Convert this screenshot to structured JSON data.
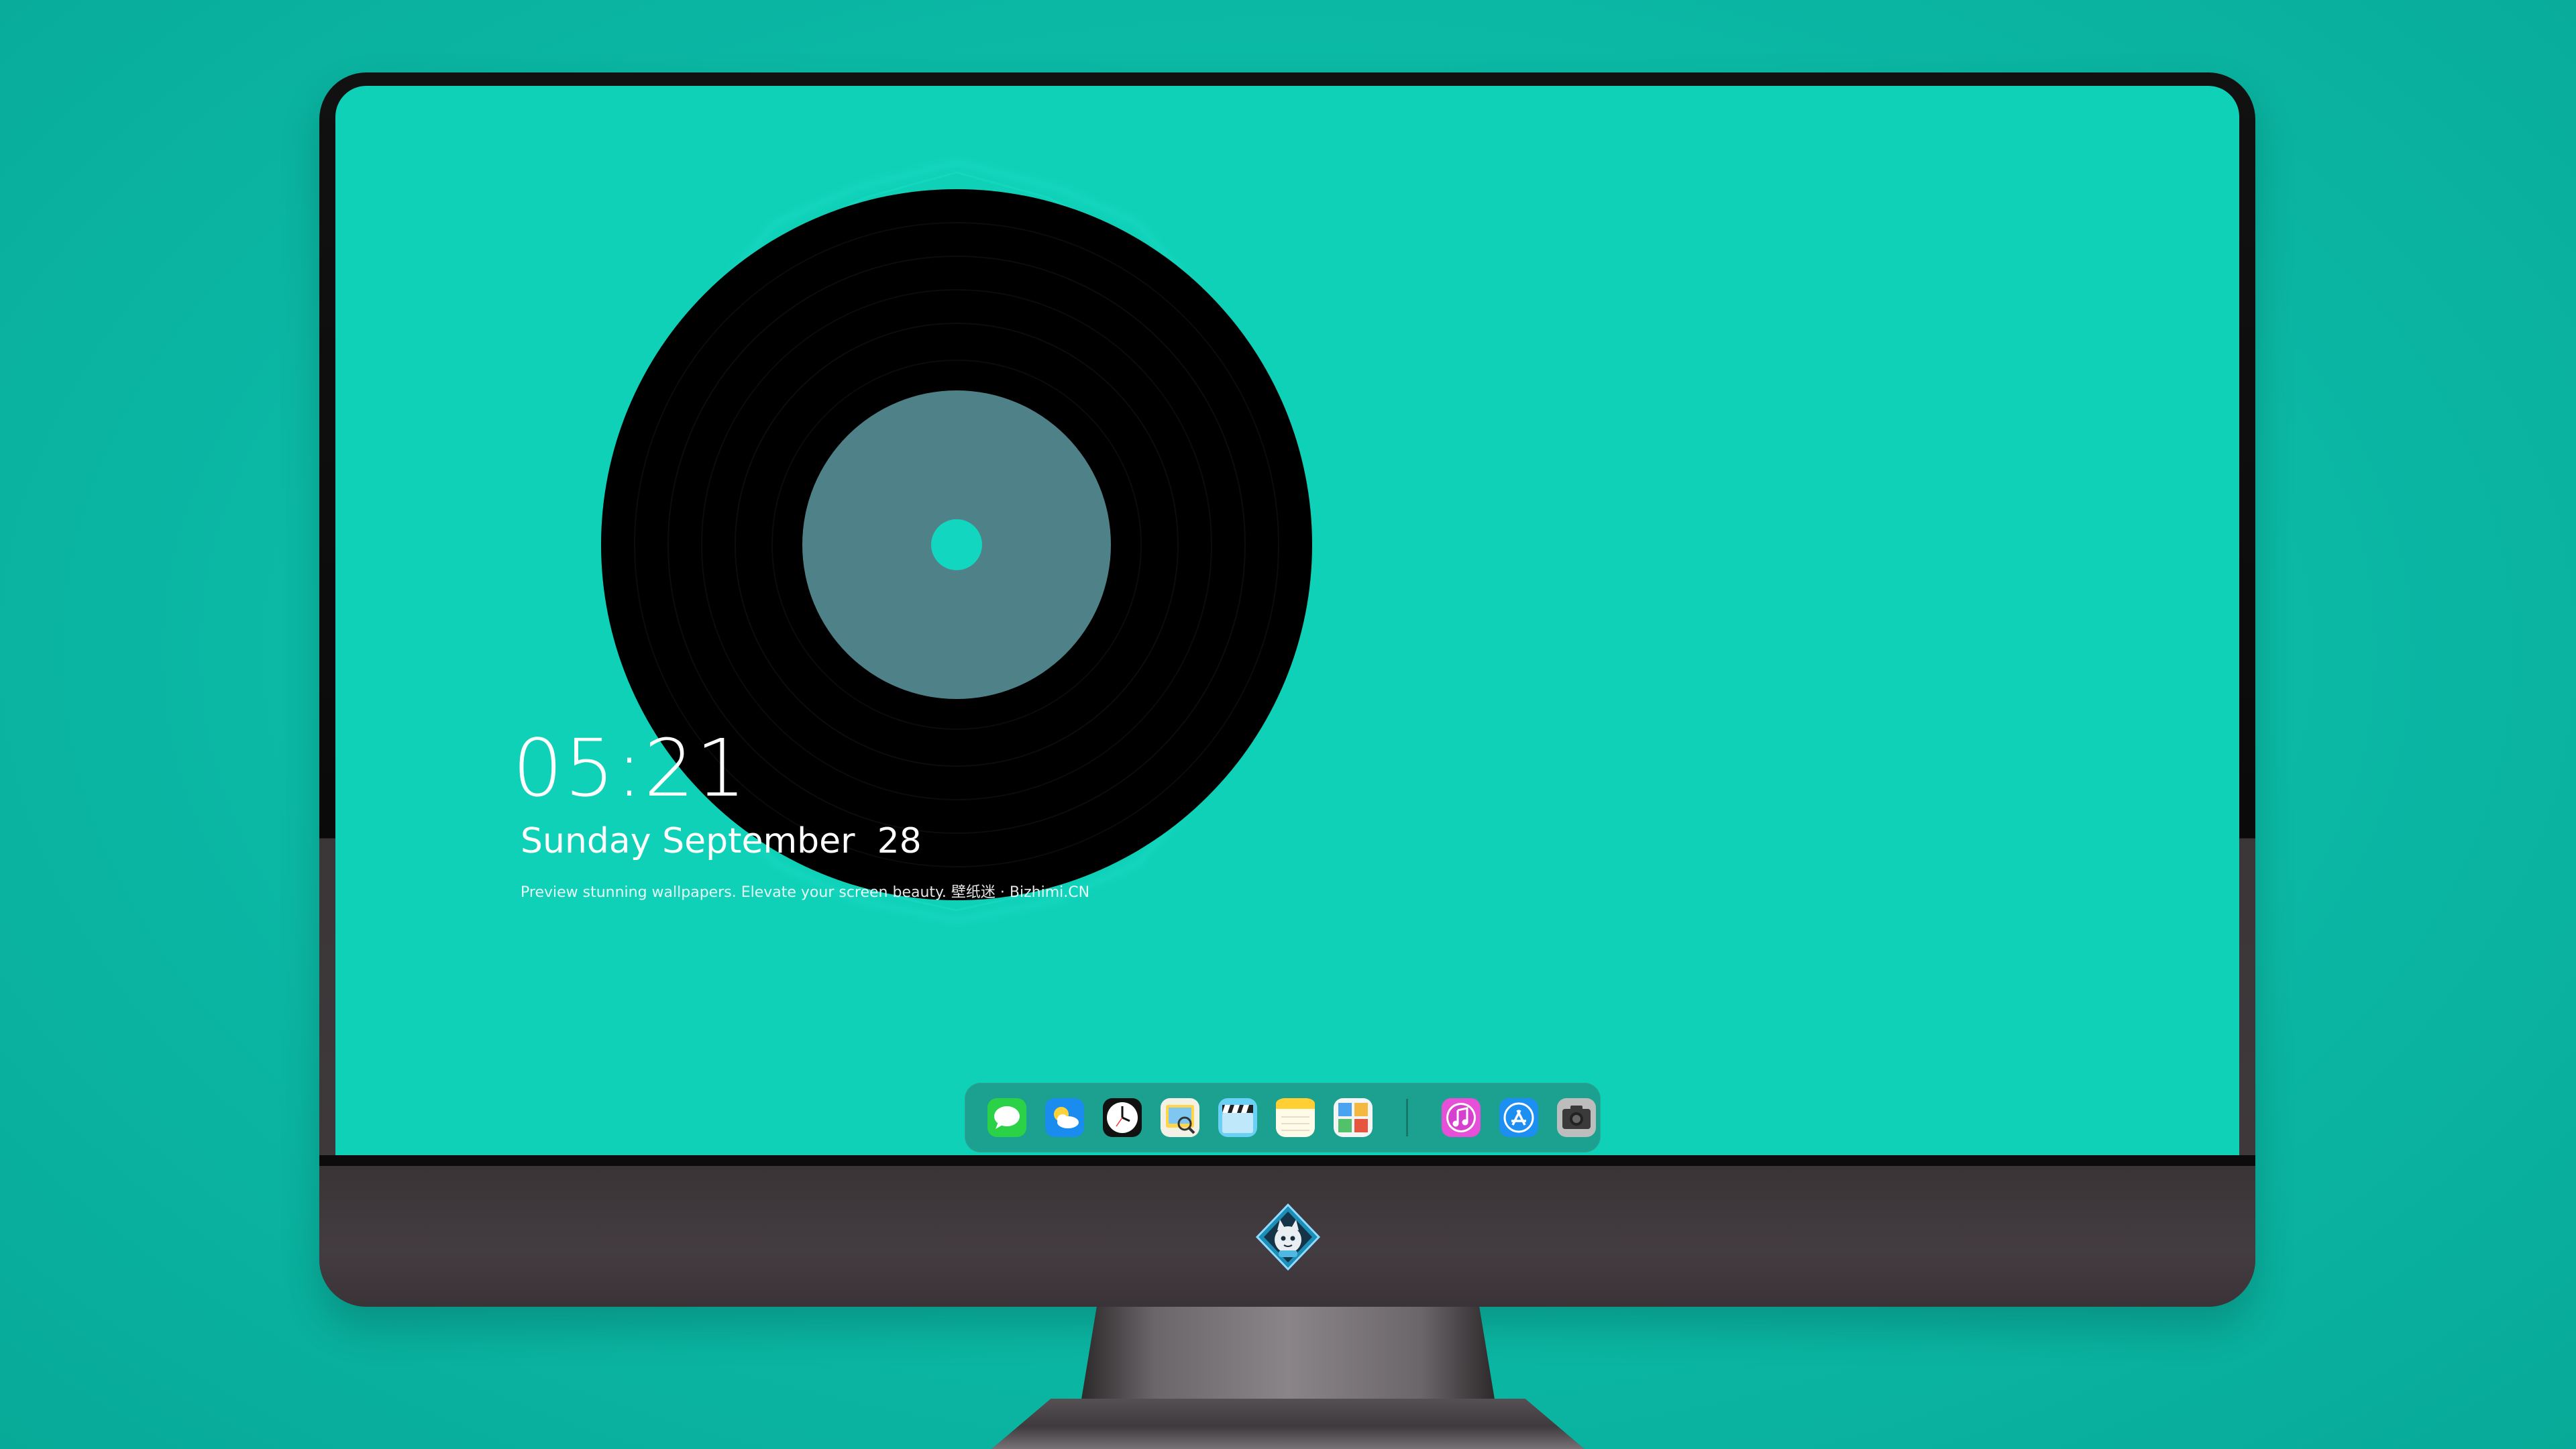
{
  "clock": {
    "time": "05:21",
    "date": "Sunday September  28",
    "tagline": "Preview stunning wallpapers. Elevate your screen beauty. 壁纸迷 · Bizhimi.CN"
  },
  "colors": {
    "background": "#0ab8a4",
    "screen": "#0fd1b8",
    "record": "#000000",
    "label": "#4f8188",
    "accent": "#12d6bf"
  },
  "dock": {
    "apps": [
      {
        "icon": "messages-icon"
      },
      {
        "icon": "weather-icon"
      },
      {
        "icon": "clock-icon"
      },
      {
        "icon": "preview-icon"
      },
      {
        "icon": "clapperboard-icon"
      },
      {
        "icon": "notes-icon"
      },
      {
        "icon": "photo-gallery-icon"
      }
    ],
    "pinned": [
      {
        "icon": "music-icon"
      },
      {
        "icon": "app-store-icon"
      },
      {
        "icon": "camera-icon"
      }
    ]
  },
  "monitor": {
    "logo_icon": "cat-mascot-icon"
  }
}
